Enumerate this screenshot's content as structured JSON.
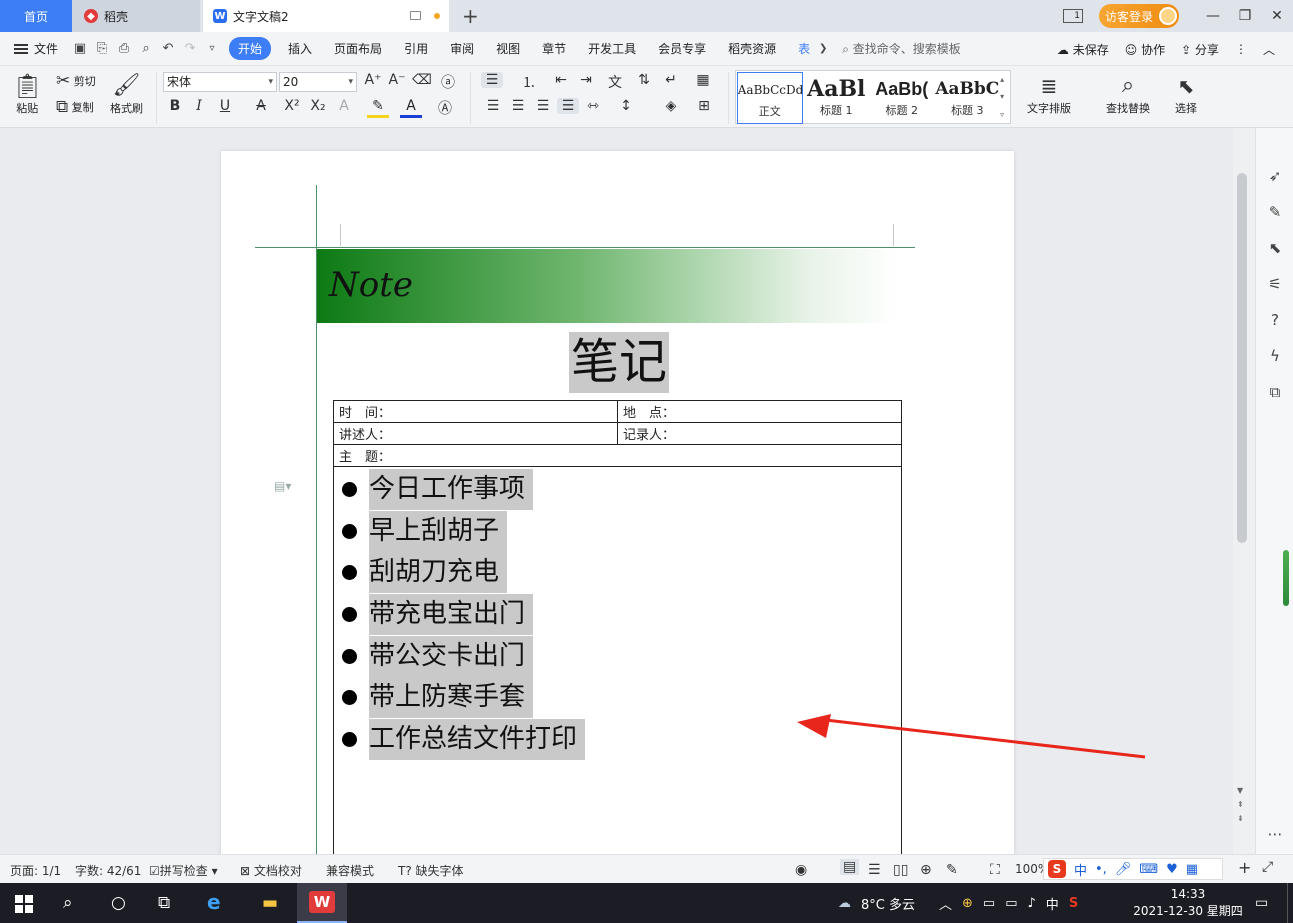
{
  "tabs": {
    "home": "首页",
    "daoke": "稻壳",
    "document": "文字文稿2"
  },
  "titlebar": {
    "window_count": "1",
    "login": "访客登录"
  },
  "menu": {
    "file": "文件",
    "items": [
      "开始",
      "插入",
      "页面布局",
      "引用",
      "审阅",
      "视图",
      "章节",
      "开发工具",
      "会员专享",
      "稻壳资源",
      "表"
    ],
    "search": "查找命令、搜索模板",
    "unsaved": "未保存",
    "collab": "协作",
    "share": "分享"
  },
  "ribbon": {
    "paste": "粘贴",
    "cut": "剪切",
    "copy": "复制",
    "format_painter": "格式刷",
    "font_name": "宋体",
    "font_size": "20",
    "styles": [
      {
        "preview": "AaBbCcDd",
        "label": "正文"
      },
      {
        "preview": "AaBl",
        "label": "标题 1"
      },
      {
        "preview": "AaBb(",
        "label": "标题 2"
      },
      {
        "preview": "AaBbC",
        "label": "标题 3"
      }
    ],
    "text_layout": "文字排版",
    "find_replace": "查找替换",
    "select": "选择"
  },
  "document": {
    "banner": "Note",
    "title": "笔记",
    "table": {
      "time": "时　间：",
      "place": "地　点：",
      "speaker": "讲述人：",
      "recorder": "记录人：",
      "topic": "主　题："
    },
    "bullets": [
      "今日工作事项",
      "早上刮胡子",
      "刮胡刀充电",
      "带充电宝出门",
      "带公交卡出门",
      "带上防寒手套",
      "工作总结文件打印"
    ]
  },
  "statusbar": {
    "page": "页面: 1/1",
    "words": "字数: 42/61",
    "spell": "拼写检查",
    "proof": "文档校对",
    "compat": "兼容模式",
    "missing_font": "缺失字体",
    "zoom": "100%",
    "ime_mode": "中"
  },
  "taskbar": {
    "weather": "8°C 多云",
    "lang": "中",
    "time": "14:33",
    "date": "2021-12-30 星期四"
  },
  "colors": {
    "accent": "#3d7ef6",
    "banner_green": "#0d7a14",
    "highlight": "#c9c9c9",
    "arrow": "#e8261c"
  }
}
